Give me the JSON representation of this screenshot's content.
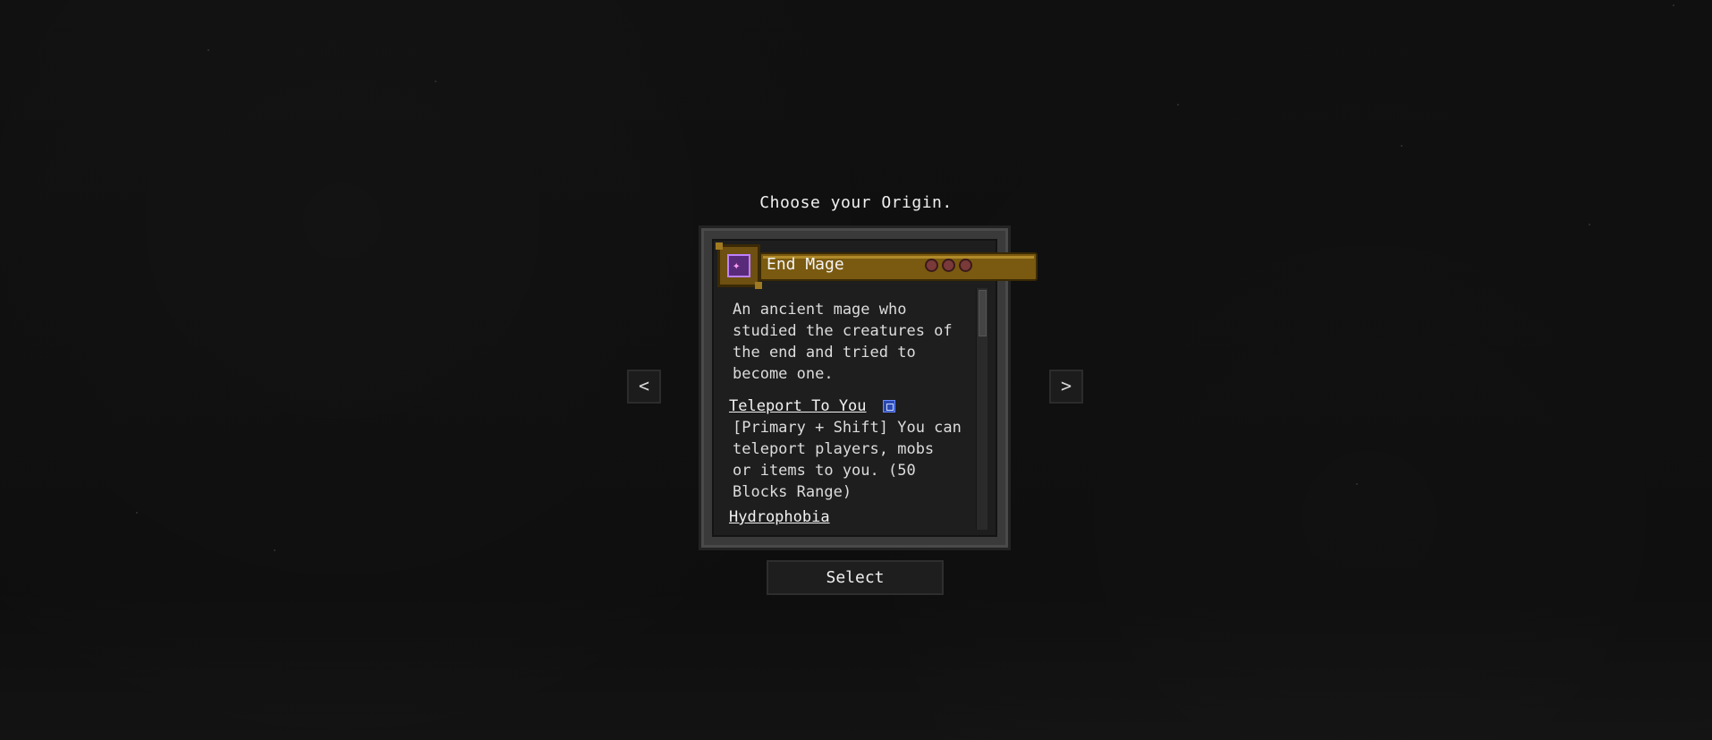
{
  "screen": {
    "title": "Choose your Origin."
  },
  "navigation": {
    "prev_glyph": "<",
    "next_glyph": ">"
  },
  "origin": {
    "name": "End Mage",
    "icon": "ender-pearl-icon",
    "impact_level": 3,
    "impact_max": 3,
    "description": "An ancient mage who\nstudied the creatures of\nthe end and tried to\nbecome one.",
    "powers": [
      {
        "name": "Teleport To You",
        "has_keybind": true,
        "description": "[Primary + Shift] You can\nteleport players, mobs\nor items to you. (50\nBlocks Range)"
      },
      {
        "name": "Hydrophobia"
      }
    ]
  },
  "actions": {
    "select_label": "Select"
  },
  "colors": {
    "header_gold": "#7a5a10",
    "panel_bg": "#1e1e1e",
    "frame_gray": "#3a3a3a",
    "impact_red": "#7a3a3a",
    "keybind_blue": "#2a4ab0"
  }
}
